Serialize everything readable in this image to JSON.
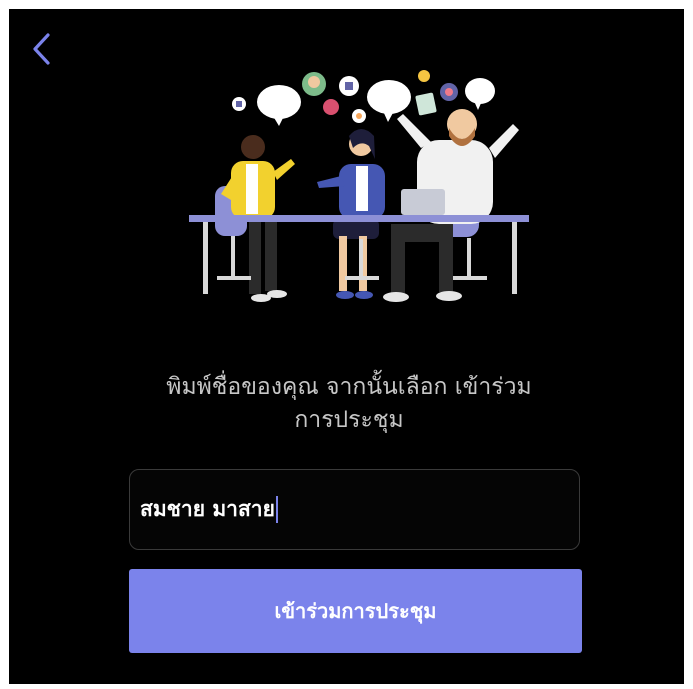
{
  "nav": {
    "back_icon": "chevron-left-icon"
  },
  "instruction": {
    "line1": "พิมพ์ชื่อของคุณ จากนั้นเลือก เข้าร่วม",
    "line2": "การประชุม"
  },
  "name_input": {
    "value": "สมชาย มาสาย"
  },
  "join_button": {
    "label": "เข้าร่วมการประชุม"
  },
  "colors": {
    "accent": "#7b83eb",
    "background": "#000000"
  }
}
